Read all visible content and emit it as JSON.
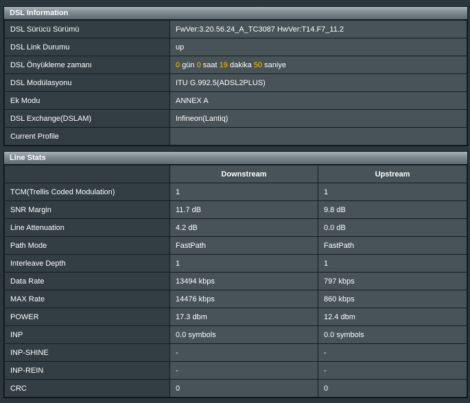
{
  "dsl_info": {
    "title": "DSL Information",
    "rows": [
      {
        "label": "DSL Sürücü Sürümü",
        "value": "FwVer:3.20.56.24_A_TC3087 HwVer:T14.F7_11.2"
      },
      {
        "label": "DSL Link Durumu",
        "value": "up"
      },
      {
        "label": "DSL Önyükleme zamanı",
        "uptime": {
          "days": "0",
          "days_unit": "gün",
          "hours": "0",
          "hours_unit": "saat",
          "minutes": "19",
          "minutes_unit": "dakika",
          "seconds": "50",
          "seconds_unit": "saniye"
        }
      },
      {
        "label": "DSL Modülasyonu",
        "value": "ITU G.992.5(ADSL2PLUS)"
      },
      {
        "label": "Ek Modu",
        "value": "ANNEX A"
      },
      {
        "label": "DSL Exchange(DSLAM)",
        "value": "Infineon(Lantiq)"
      },
      {
        "label": "Current Profile",
        "value": ""
      }
    ]
  },
  "line_stats": {
    "title": "Line Stats",
    "col_downstream": "Downstream",
    "col_upstream": "Upstream",
    "rows": [
      {
        "label": "TCM(Trellis Coded Modulation)",
        "down": "1",
        "up": "1"
      },
      {
        "label": "SNR Margin",
        "down": "11.7 dB",
        "up": "9.8 dB"
      },
      {
        "label": "Line Attenuation",
        "down": "4.2 dB",
        "up": "0.0 dB"
      },
      {
        "label": "Path Mode",
        "down": "FastPath",
        "up": "FastPath"
      },
      {
        "label": "Interleave Depth",
        "down": "1",
        "up": "1"
      },
      {
        "label": "Data Rate",
        "down": "13494 kbps",
        "up": "797 kbps"
      },
      {
        "label": "MAX Rate",
        "down": "14476 kbps",
        "up": "860 kbps"
      },
      {
        "label": "POWER",
        "down": "17.3 dbm",
        "up": "12.4 dbm"
      },
      {
        "label": "INP",
        "down": "0.0 symbols",
        "up": "0.0 symbols"
      },
      {
        "label": "INP-SHINE",
        "down": "-",
        "up": "-"
      },
      {
        "label": "INP-REIN",
        "down": "-",
        "up": "-"
      },
      {
        "label": "CRC",
        "down": "0",
        "up": "0"
      }
    ]
  },
  "colors": {
    "highlight": "#ffc000",
    "label_bg": "#323e42",
    "value_bg": "#475357",
    "page_bg": "#2b373b"
  }
}
